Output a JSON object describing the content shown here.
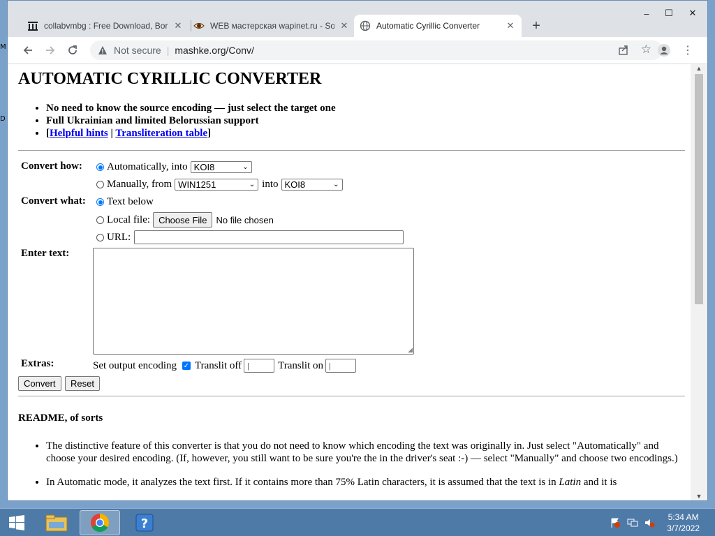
{
  "desktop": {
    "hint_top": "M",
    "hint_mid": "D"
  },
  "tabs": [
    {
      "title": "collabvmbg : Free Download, Bor",
      "icon": "archive-icon",
      "active": false
    },
    {
      "title": "WEB мастерская wapinet.ru - So",
      "icon": "eye-icon",
      "active": false
    },
    {
      "title": "Automatic Cyrillic Converter",
      "icon": "globe-icon",
      "active": true
    }
  ],
  "window_controls": {
    "minimize": "–",
    "maximize": "☐",
    "close": "✕"
  },
  "address_bar": {
    "security": "Not secure",
    "separator": "|",
    "url": "mashke.org/Conv/"
  },
  "page": {
    "title": "AUTOMATIC CYRILLIC CONVERTER",
    "intro": {
      "item1": "No need to know the source encoding — just select the target one",
      "item2": "Full Ukrainian and limited Belorussian support",
      "bracket_open": "[",
      "link1": "Helpful hints",
      "pipe": " | ",
      "link2": "Transliteration table",
      "bracket_close": "]"
    },
    "form": {
      "convert_how_label": "Convert how:",
      "auto_label": "Automatically, into",
      "auto_target": "KOI8",
      "manual_label": "Manually, from",
      "manual_from": "WIN1251",
      "into_label": "into",
      "manual_to": "KOI8",
      "convert_what_label": "Convert what:",
      "text_below_label": "Text below",
      "local_file_label": "Local file:",
      "choose_file": "Choose File",
      "no_file": "No file chosen",
      "url_label": "URL:",
      "enter_text_label": "Enter text:",
      "extras_label": "Extras:",
      "set_output": "Set output encoding",
      "translit_off": "Translit off",
      "translit_off_value": "|",
      "translit_on": "Translit on",
      "translit_on_value": "|",
      "convert_button": "Convert",
      "reset_button": "Reset"
    },
    "readme": {
      "heading": "README, of sorts",
      "p1": "The distinctive feature of this converter is that you do not need to know which encoding the text was originally in. Just select \"Automatically\" and choose your desired encoding. (If, however, you still want to be sure you're the in the driver's seat :-) — select \"Manually\" and choose two encodings.)",
      "p2_start": "In Automatic mode, it analyzes the text first. If it contains more than 75% Latin characters, it is assumed that the text is in ",
      "p2_italic": "Latin",
      "p2_end": " and it is"
    }
  },
  "taskbar": {
    "time": "5:34 AM",
    "date": "3/7/2022",
    "items": [
      "start-button",
      "file-explorer",
      "chrome",
      "help"
    ]
  },
  "colors": {
    "accent": "#0075ff",
    "link": "#0000ee",
    "taskbar": "#4e7aa8"
  }
}
